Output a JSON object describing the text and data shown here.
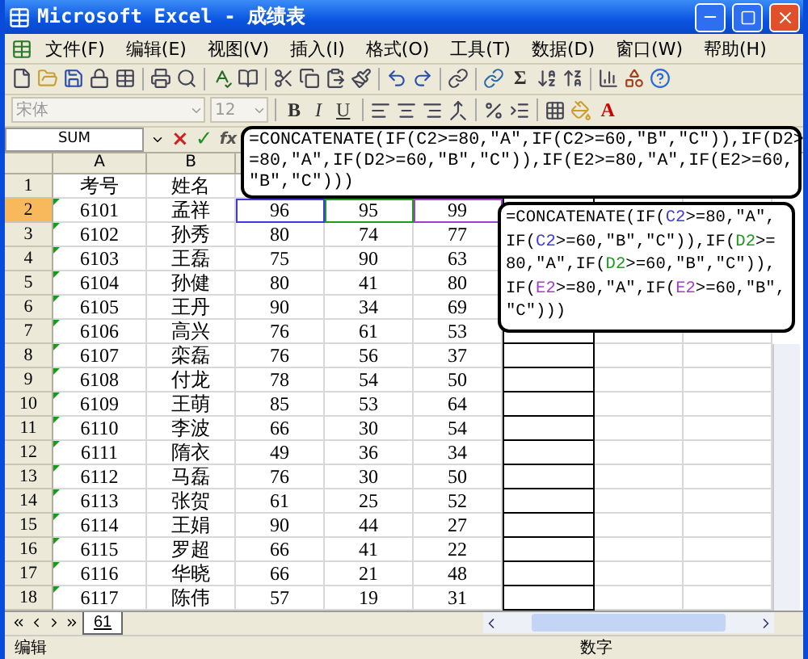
{
  "window": {
    "title": "Microsoft Excel - 成绩表"
  },
  "menu": [
    "文件(F)",
    "编辑(E)",
    "视图(V)",
    "插入(I)",
    "格式(O)",
    "工具(T)",
    "数据(D)",
    "窗口(W)",
    "帮助(H)"
  ],
  "toolbar": {
    "sum_symbol": "Σ"
  },
  "format_bar": {
    "font": "宋体",
    "size": "12",
    "bold": "B",
    "italic": "I",
    "underline": "U",
    "font_color": "A"
  },
  "formula_bar": {
    "name_box": "SUM",
    "cancel": "×",
    "enter": "✓",
    "fx": "fx"
  },
  "formula_callout": [
    "=CONCATENATE(IF(C2>=80,\"A\",IF(C2>=60,\"B\",\"C\")),IF(D2>",
    "=80,\"A\",IF(D2>=60,\"B\",\"C\")),IF(E2>=80,\"A\",IF(E2>=60,",
    "\"B\",\"C\")))"
  ],
  "cell_callout": [
    [
      {
        "text": "=CONCATENATE(IF("
      },
      {
        "text": "C2",
        "color": "#3c3cdc"
      },
      {
        "text": ">=80,\"A\","
      }
    ],
    [
      {
        "text": "IF("
      },
      {
        "text": "C2",
        "color": "#3c3cdc"
      },
      {
        "text": ">=60,\"B\",\"C\")),IF("
      },
      {
        "text": "D2",
        "color": "#1e9a1e"
      },
      {
        "text": ">="
      }
    ],
    [
      {
        "text": "80,\"A\",IF("
      },
      {
        "text": "D2",
        "color": "#1e9a1e"
      },
      {
        "text": ">=60,\"B\",\"C\")),"
      }
    ],
    [
      {
        "text": "IF("
      },
      {
        "text": "E2",
        "color": "#a040c8"
      },
      {
        "text": ">=80,\"A\",IF("
      },
      {
        "text": "E2",
        "color": "#a040c8"
      },
      {
        "text": ">=60,\"B\","
      }
    ],
    [
      {
        "text": "\"C\")))"
      }
    ]
  ],
  "columns": [
    "A",
    "B"
  ],
  "rows": [
    {
      "number": "1",
      "selected": false,
      "cells": [
        "考号",
        "姓名"
      ]
    },
    {
      "number": "2",
      "selected": true,
      "cells": [
        "6101",
        "孟祥",
        {
          "text": "96",
          "color": "#3c3cdc"
        },
        {
          "text": "95",
          "color": "#1e9a1e"
        },
        {
          "text": "99",
          "color": "#a040c8"
        }
      ]
    },
    {
      "number": "3",
      "selected": false,
      "cells": [
        "6102",
        "孙秀",
        "80",
        "74",
        "77"
      ]
    },
    {
      "number": "4",
      "selected": false,
      "cells": [
        "6103",
        "王磊",
        "75",
        "90",
        "63"
      ]
    },
    {
      "number": "5",
      "selected": false,
      "cells": [
        "6104",
        "孙健",
        "80",
        "41",
        "80"
      ]
    },
    {
      "number": "6",
      "selected": false,
      "cells": [
        "6105",
        "王丹",
        "90",
        "34",
        "69"
      ]
    },
    {
      "number": "7",
      "selected": false,
      "cells": [
        "6106",
        "高兴",
        "76",
        "61",
        "53"
      ]
    },
    {
      "number": "8",
      "selected": false,
      "cells": [
        "6107",
        "栾磊",
        "76",
        "56",
        "37"
      ]
    },
    {
      "number": "9",
      "selected": false,
      "cells": [
        "6108",
        "付龙",
        "78",
        "54",
        "50"
      ]
    },
    {
      "number": "10",
      "selected": false,
      "cells": [
        "6109",
        "王萌",
        "85",
        "53",
        "64"
      ]
    },
    {
      "number": "11",
      "selected": false,
      "cells": [
        "6110",
        "李波",
        "66",
        "30",
        "54"
      ]
    },
    {
      "number": "12",
      "selected": false,
      "cells": [
        "6111",
        "隋衣",
        "49",
        "36",
        "34"
      ]
    },
    {
      "number": "13",
      "selected": false,
      "cells": [
        "6112",
        "马磊",
        "76",
        "30",
        "50"
      ]
    },
    {
      "number": "14",
      "selected": false,
      "cells": [
        "6113",
        "张贺",
        "61",
        "25",
        "52"
      ]
    },
    {
      "number": "15",
      "selected": false,
      "cells": [
        "6114",
        "王娟",
        "90",
        "44",
        "27"
      ]
    },
    {
      "number": "16",
      "selected": false,
      "cells": [
        "6115",
        "罗超",
        "66",
        "41",
        "22"
      ]
    },
    {
      "number": "17",
      "selected": false,
      "cells": [
        "6116",
        "华晓",
        "66",
        "21",
        "48"
      ]
    },
    {
      "number": "18",
      "selected": false,
      "cells": [
        "6117",
        "陈伟",
        "57",
        "19",
        "31"
      ]
    }
  ],
  "sheet_tabs": [
    {
      "label": "61",
      "selected": true
    }
  ],
  "status_bar": {
    "mode": "编辑",
    "indicator": "数字"
  }
}
